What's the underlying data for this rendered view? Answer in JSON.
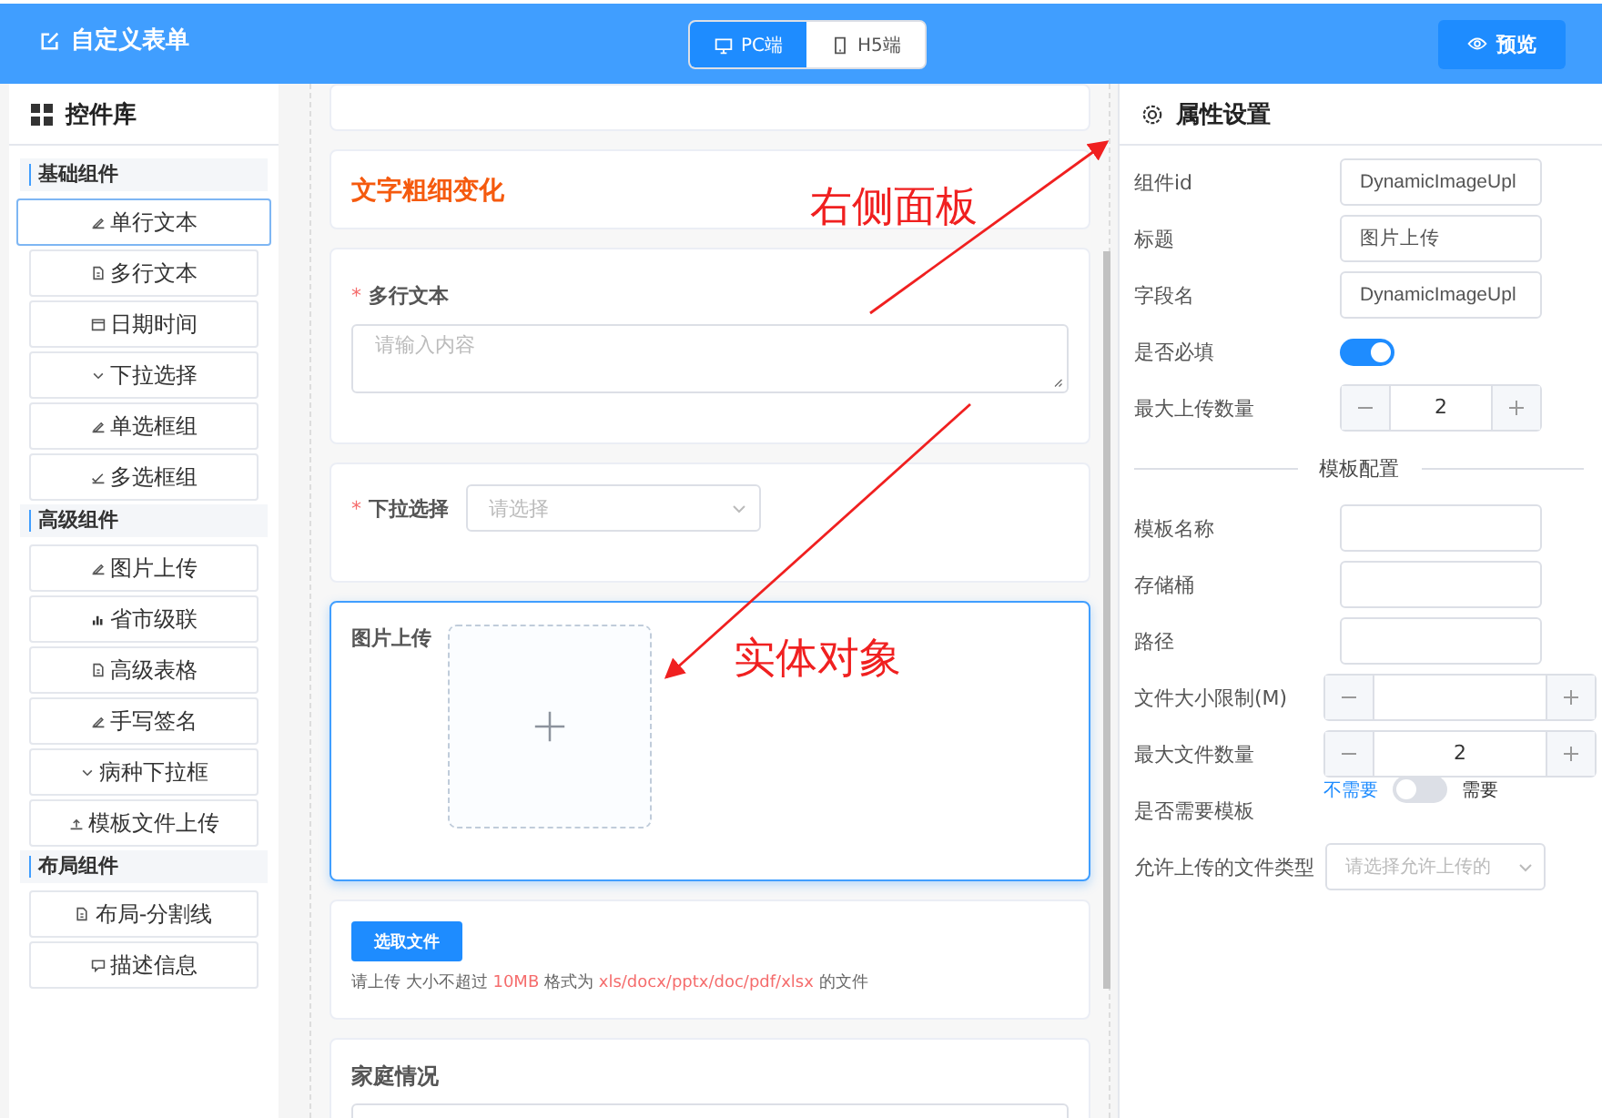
{
  "header": {
    "title": "自定义表单",
    "view_tabs": [
      {
        "label": "PC端",
        "kind": "desktop",
        "selected": true
      },
      {
        "label": "H5端",
        "kind": "mobile",
        "selected": false
      }
    ],
    "preview_button": "预览"
  },
  "component_library": {
    "title": "控件库",
    "groups": [
      {
        "title": "基础组件",
        "items": [
          {
            "label": "单行文本",
            "kind": "pen",
            "selected": true
          },
          {
            "label": "多行文本",
            "kind": "doc",
            "selected": false
          },
          {
            "label": "日期时间",
            "kind": "calendar",
            "selected": false
          },
          {
            "label": "下拉选择",
            "kind": "chevron",
            "selected": false
          },
          {
            "label": "单选框组",
            "kind": "pen",
            "selected": false
          },
          {
            "label": "多选框组",
            "kind": "check",
            "selected": false
          }
        ]
      },
      {
        "title": "高级组件",
        "items": [
          {
            "label": "图片上传",
            "kind": "pen",
            "selected": false
          },
          {
            "label": "省市级联",
            "kind": "bars",
            "selected": false
          },
          {
            "label": "高级表格",
            "kind": "doc",
            "selected": false
          },
          {
            "label": "手写签名",
            "kind": "pen",
            "selected": false
          },
          {
            "label": "病种下拉框",
            "kind": "chevron",
            "selected": false
          },
          {
            "label": "模板文件上传",
            "kind": "upload",
            "selected": false
          }
        ]
      },
      {
        "title": "布局组件",
        "items": [
          {
            "label": "布局-分割线",
            "kind": "doc",
            "selected": false
          },
          {
            "label": "描述信息",
            "kind": "chat",
            "selected": false
          }
        ]
      }
    ]
  },
  "canvas": {
    "cards": [
      {
        "kind": "blank",
        "selected": false
      },
      {
        "kind": "heading",
        "text": "文字粗细变化",
        "selected": false
      },
      {
        "kind": "textarea",
        "required_mark": "*",
        "label": "多行文本",
        "placeholder": "请输入内容",
        "selected": false
      },
      {
        "kind": "select",
        "required_mark": "*",
        "label": "下拉选择",
        "placeholder": "请选择",
        "selected": false
      },
      {
        "kind": "image_upload",
        "label": "图片上传",
        "selected": true
      },
      {
        "kind": "file_upload",
        "button": "选取文件",
        "hint": [
          {
            "text": "请上传 大小不超过 ",
            "highlight": false
          },
          {
            "text": "10MB",
            "highlight": true
          },
          {
            "text": " 格式为 ",
            "highlight": false
          },
          {
            "text": "xls/docx/pptx/doc/pdf/xlsx",
            "highlight": true
          },
          {
            "text": " 的文件",
            "highlight": false
          }
        ],
        "selected": false
      },
      {
        "kind": "input",
        "label": "家庭情况",
        "selected": false
      }
    ]
  },
  "properties": {
    "title": "属性设置",
    "rows": [
      {
        "kind": "input",
        "label": "组件id",
        "value": "DynamicImageUpl"
      },
      {
        "kind": "input",
        "label": "标题",
        "value": "图片上传"
      },
      {
        "kind": "input",
        "label": "字段名",
        "value": "DynamicImageUpl"
      },
      {
        "kind": "switch",
        "label": "是否必填",
        "on": true
      },
      {
        "kind": "number",
        "label": "最大上传数量",
        "value": "2",
        "wide": false
      },
      {
        "kind": "divider",
        "label": "模板配置"
      },
      {
        "kind": "input",
        "label": "模板名称",
        "value": ""
      },
      {
        "kind": "input",
        "label": "存储桶",
        "value": ""
      },
      {
        "kind": "input",
        "label": "路径",
        "value": ""
      },
      {
        "kind": "number",
        "label": "文件大小限制(M)",
        "value": "",
        "wide": true
      },
      {
        "kind": "number",
        "label": "最大文件数量",
        "value": "2",
        "wide": true
      },
      {
        "kind": "labeled_switch",
        "label": "是否需要模板",
        "off_text": "不需要",
        "on_text": "需要",
        "on": false
      },
      {
        "kind": "select",
        "label": "允许上传的文件类型",
        "placeholder": "请选择允许上传的"
      }
    ]
  },
  "annotations": [
    {
      "text": "右侧面板"
    },
    {
      "text": "实体对象"
    }
  ]
}
